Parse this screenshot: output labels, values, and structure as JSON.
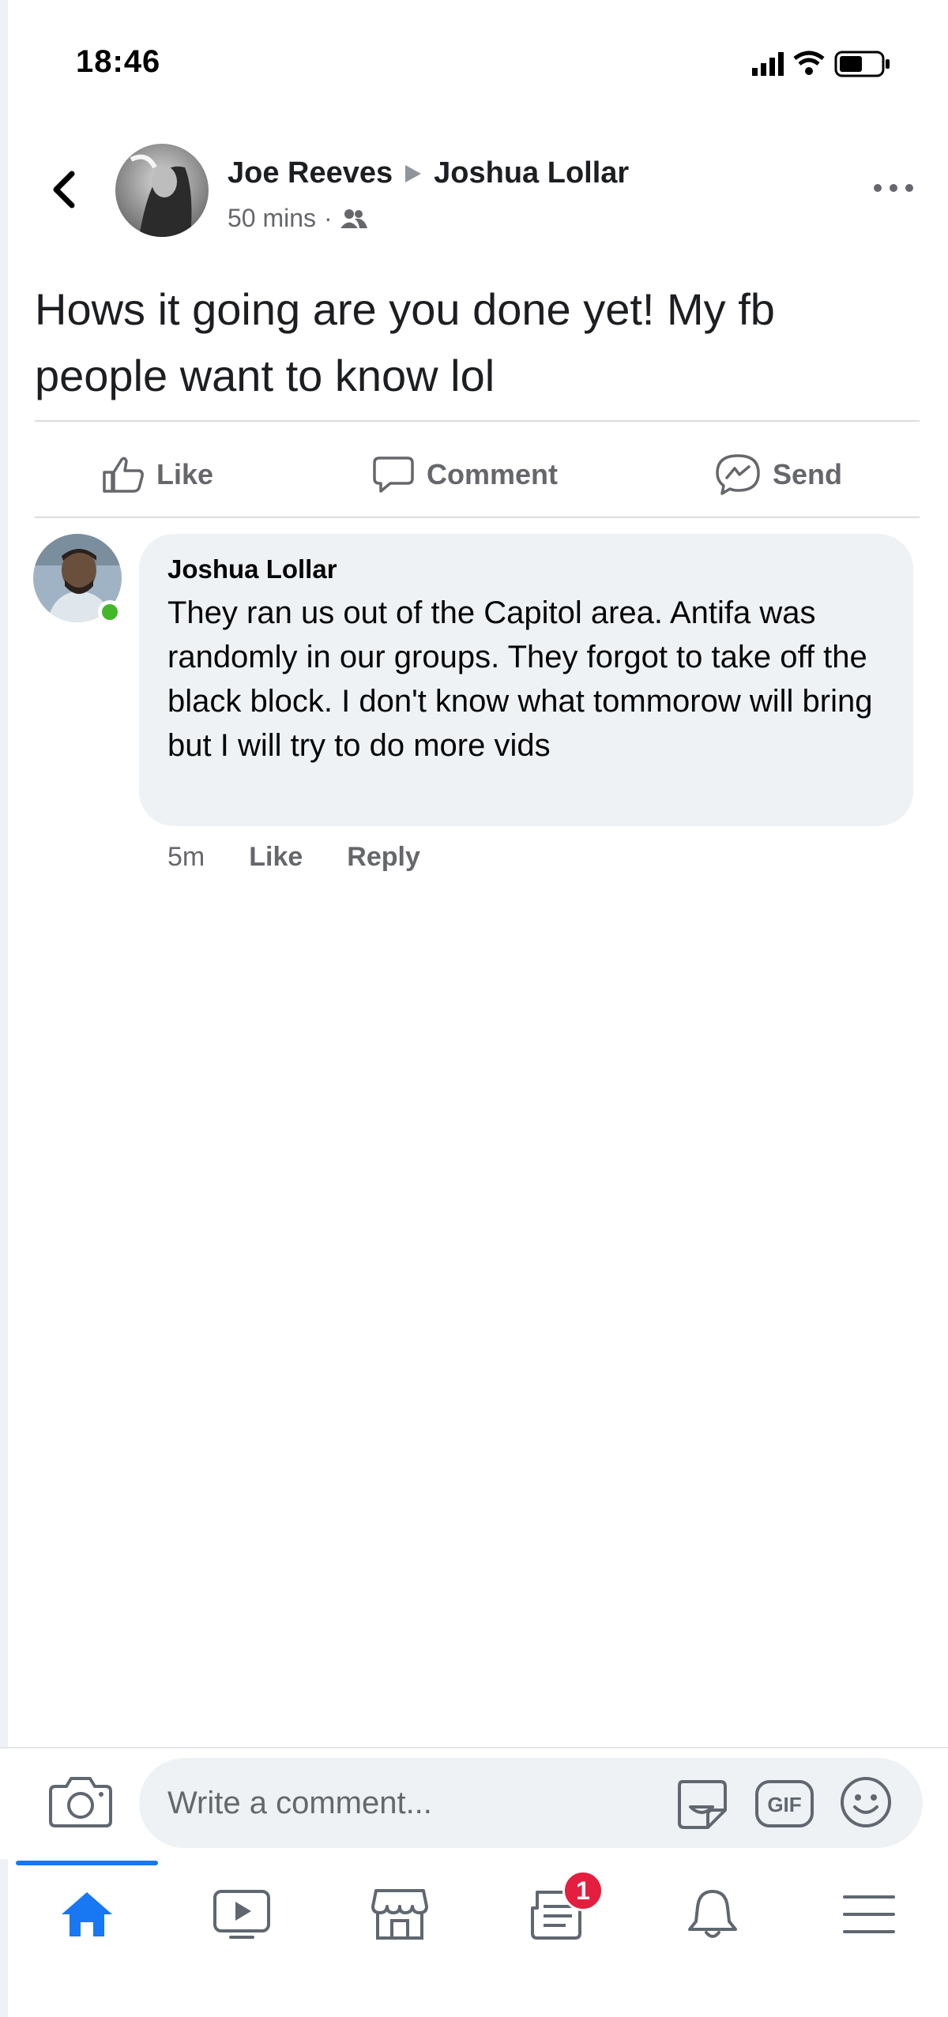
{
  "status_bar": {
    "time": "18:46"
  },
  "post": {
    "author": "Joe Reeves",
    "recipient": "Joshua Lollar",
    "time": "50 mins",
    "separator": "·",
    "text": "Hows it going are you done yet! My fb people want to know lol"
  },
  "actions": {
    "like": "Like",
    "comment": "Comment",
    "send": "Send"
  },
  "comment": {
    "author": "Joshua Lollar",
    "text": "They ran us out of the Capitol area. Antifa was randomly in our groups. They forgot to take off the black block. I don't know what tommorow will bring but I will try to do more vids",
    "time": "5m",
    "like_label": "Like",
    "reply_label": "Reply",
    "author_online": true
  },
  "composer": {
    "placeholder": "Write a comment..."
  },
  "nav": {
    "active": "home",
    "notification_badge": "1"
  },
  "colors": {
    "accent": "#1877f2",
    "online": "#42b72a",
    "badge": "#e41e3f",
    "bubble": "#eff2f5",
    "secondary_text": "#65676b"
  },
  "icons": [
    "back-icon",
    "more-icon",
    "friends-icon",
    "like-icon",
    "comment-icon",
    "messenger-icon",
    "camera-icon",
    "sticker-icon",
    "gif-icon",
    "emoji-icon",
    "home-icon",
    "watch-icon",
    "marketplace-icon",
    "news-icon",
    "bell-icon",
    "menu-icon"
  ]
}
